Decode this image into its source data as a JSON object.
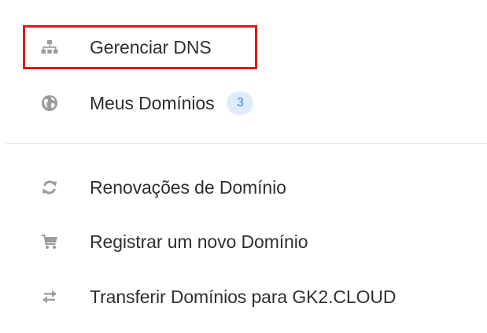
{
  "menu": {
    "group1": [
      {
        "label": "Gerenciar DNS",
        "icon": "sitemap-icon"
      },
      {
        "label": "Meus Domínios",
        "icon": "globe-icon",
        "badge": "3"
      }
    ],
    "group2": [
      {
        "label": "Renovações de Domínio",
        "icon": "renew-icon"
      },
      {
        "label": "Registrar um novo Domínio",
        "icon": "cart-icon"
      },
      {
        "label": "Transferir Domínios para GK2.CLOUD",
        "icon": "transfer-icon"
      }
    ]
  },
  "colors": {
    "icon": "#9b9b9b",
    "text": "#2f2f2f",
    "highlight": "#e01818",
    "badge_bg": "#e1ecfb",
    "badge_text": "#3a82e8"
  }
}
